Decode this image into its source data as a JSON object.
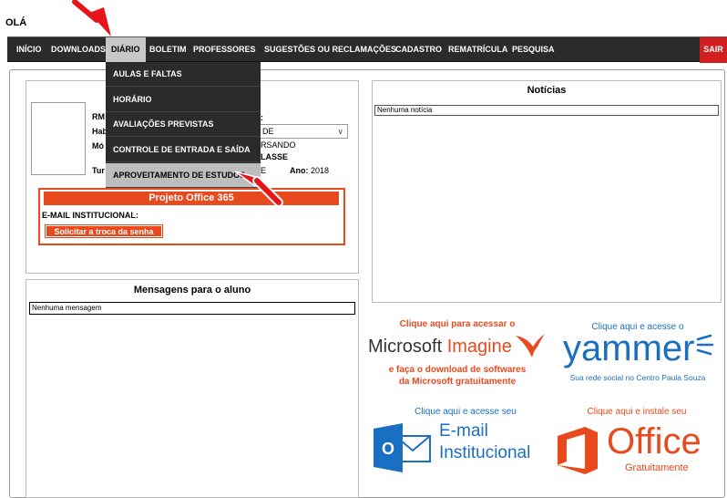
{
  "header": {
    "greeting": "OLÁ"
  },
  "nav": {
    "items": [
      "INÍCIO",
      "DOWNLOADS",
      "DIÁRIO",
      "BOLETIM",
      "PROFESSORES",
      "SUGESTÕES OU RECLAMAÇÕES",
      "CADASTRO",
      "REMATRÍCULA",
      "PESQUISA"
    ],
    "exit": "SAIR"
  },
  "diario_menu": [
    "AULAS E FALTAS",
    "HORÁRIO",
    "AVALIAÇÕES PREVISTAS",
    "CONTROLE DE ENTRADA E SAÍDA",
    "APROVEITAMENTO DE ESTUDOS"
  ],
  "student": {
    "rm_label": "RM:",
    "hab_label": "Hab",
    "mod_label": "Mó",
    "tur_label": "Tur",
    "module_select_value": "DE",
    "cursando": "RSANDO",
    "classe": "LASSE",
    "partial_e": "E",
    "ano_label": "Ano:",
    "ano_value": "2018",
    "partial_colon": ":"
  },
  "office": {
    "title": "Projeto Office 365",
    "email_label": "E-MAIL INSTITUCIONAL:",
    "button": "Solicitar a troca da senha"
  },
  "messages": {
    "title": "Mensagens para o aluno",
    "empty": "Nenhuma mensagem"
  },
  "news": {
    "title": "Notícias",
    "empty": "Nenhuma notícia"
  },
  "promos": {
    "imagine": {
      "line1": "Clique aqui para acessar o",
      "brand_ms": "Microsoft",
      "brand_imagine": "Imagine",
      "line2": "e faça o download de softwares",
      "line3": "da Microsoft gratuitamente"
    },
    "yammer": {
      "line1": "Clique aqui e acesse o",
      "brand": "yammer",
      "sub": "Sua rede social no Centro Paula Souza"
    },
    "email": {
      "line1": "Clique aqui e acesse seu",
      "brand1": "E-mail",
      "brand2": "Institucional",
      "icon_letter": "O"
    },
    "office": {
      "line1": "Clique aqui e instale seu",
      "brand": "Office",
      "sub": "Gratuitamente"
    }
  },
  "colors": {
    "accent_orange": "#e8491d",
    "nav_bg": "#2b2b2b",
    "exit_red": "#d21e1e",
    "ms_blue": "#1a6fc2",
    "annotation_red": "#e8141a"
  }
}
